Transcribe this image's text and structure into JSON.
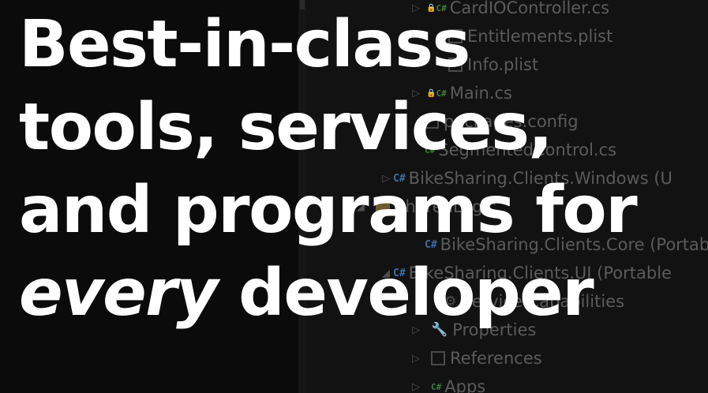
{
  "headline": {
    "line1": "Best-in-class",
    "line2": "tools, services,",
    "line3": "and programs for",
    "line4_em": "every",
    "line4_rest": " developer"
  },
  "background": {
    "solution_explorer_items": [
      "CardIOController.cs",
      "Entitlements.plist",
      "Info.plist",
      "Main.cs",
      "packages.config",
      "SegmentedControl.cs",
      "BikeSharing.Clients.Windows (U",
      "SharedLogic",
      "BikeSharing.Clients.Core (Portab",
      "BikeSharing.Clients.UI (Portable",
      "Service Capabilities",
      "Properties",
      "References",
      "Apps"
    ],
    "icons": {
      "cs_badge": "C#",
      "project_badge": "C#"
    },
    "colors": {
      "background": "#0b0b0b",
      "panel": "#121212",
      "headline": "#ffffff",
      "tree_text": "#5b5b5b"
    }
  }
}
